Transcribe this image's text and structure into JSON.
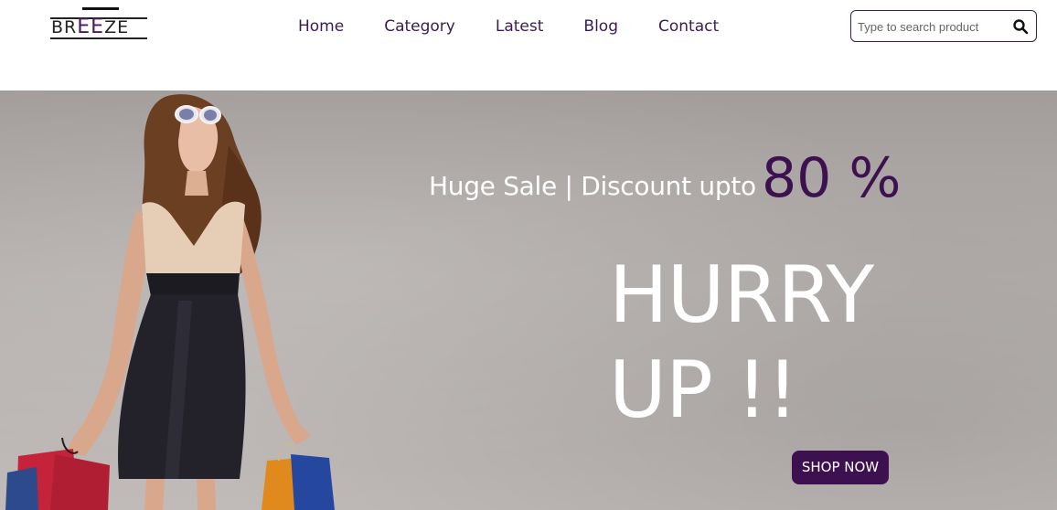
{
  "header": {
    "logo": {
      "left": "BR",
      "mid": "EE",
      "right": "ZE"
    },
    "nav": [
      {
        "label": "Home"
      },
      {
        "label": "Category"
      },
      {
        "label": "Latest"
      },
      {
        "label": "Blog"
      },
      {
        "label": "Contact"
      }
    ],
    "search": {
      "placeholder": "Type to search product",
      "value": "",
      "icon": "search-icon"
    }
  },
  "hero": {
    "sale_text": "Huge Sale | Discount upto",
    "sale_percent": "80 %",
    "headline_line1": "HURRY",
    "headline_line2": "UP !!",
    "cta_label": "SHOP NOW",
    "image": "woman-with-shopping-bags-photo"
  },
  "colors": {
    "brand_purple": "#3d1150",
    "nav_text": "#3b1c4e",
    "hero_background": "#b5b0ae",
    "hero_text": "#ffffff"
  }
}
